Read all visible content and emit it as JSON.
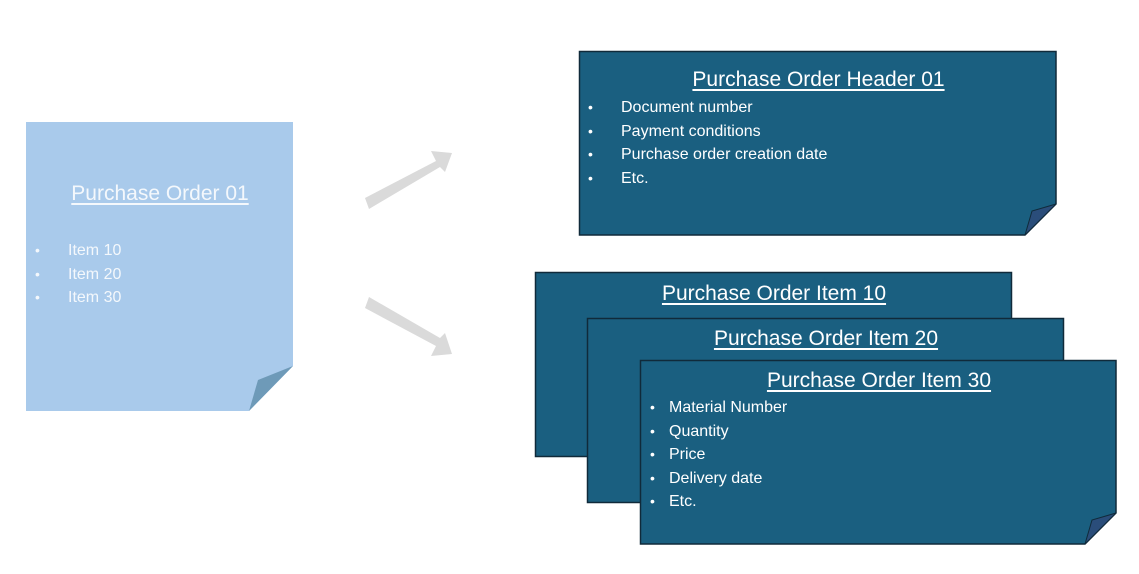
{
  "colors": {
    "light_note": "#a9caeb",
    "light_fold": "#6e9ab8",
    "dark_note": "#1a5f80",
    "dark_fold": "#2a4d7a",
    "border": "#102a3a",
    "arrow": "#dadada"
  },
  "purchase_order": {
    "title": "Purchase Order 01",
    "items": [
      "Item 10",
      "Item 20",
      "Item 30"
    ]
  },
  "header": {
    "title": "Purchase Order Header 01",
    "fields": [
      "Document number",
      "Payment conditions",
      "Purchase order creation date",
      "Etc."
    ]
  },
  "item_10": {
    "title": "Purchase Order Item 10"
  },
  "item_20": {
    "title": "Purchase Order Item 20"
  },
  "item_30": {
    "title": "Purchase Order Item 30",
    "fields": [
      "Material Number",
      "Quantity",
      "Price",
      "Delivery date",
      "Etc."
    ]
  }
}
